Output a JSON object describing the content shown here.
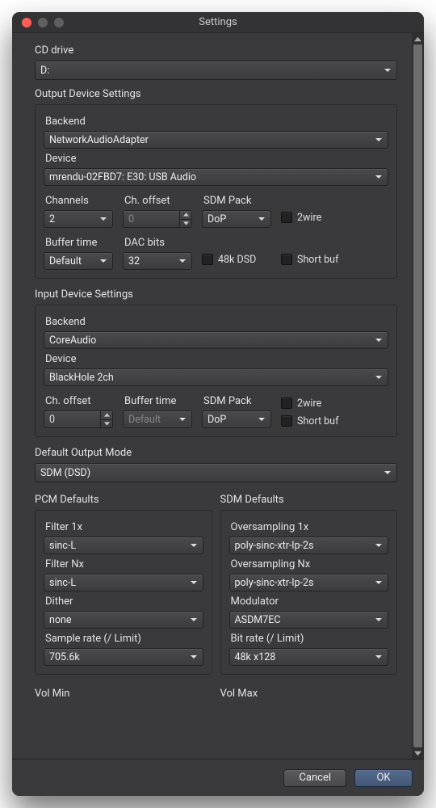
{
  "window": {
    "title": "Settings"
  },
  "cd": {
    "label": "CD drive",
    "value": "D:"
  },
  "output": {
    "title": "Output Device Settings",
    "backend_label": "Backend",
    "backend": "NetworkAudioAdapter",
    "device_label": "Device",
    "device": "mrendu-02FBD7: E30: USB Audio",
    "channels_label": "Channels",
    "channels": "2",
    "ch_offset_label": "Ch. offset",
    "ch_offset": "0",
    "sdm_pack_label": "SDM Pack",
    "sdm_pack": "DoP",
    "twowire_label": "2wire",
    "buffer_time_label": "Buffer time",
    "buffer_time": "Default",
    "dac_bits_label": "DAC bits",
    "dac_bits": "32",
    "dsd48k_label": "48k DSD",
    "short_buf_label": "Short buf"
  },
  "input": {
    "title": "Input Device Settings",
    "backend_label": "Backend",
    "backend": "CoreAudio",
    "device_label": "Device",
    "device": "BlackHole 2ch",
    "ch_offset_label": "Ch. offset",
    "ch_offset": "0",
    "buffer_time_label": "Buffer time",
    "buffer_time": "Default",
    "sdm_pack_label": "SDM Pack",
    "sdm_pack": "DoP",
    "twowire_label": "2wire",
    "short_buf_label": "Short buf"
  },
  "outmode": {
    "label": "Default Output Mode",
    "value": "SDM (DSD)"
  },
  "pcm": {
    "title": "PCM Defaults",
    "filter1x_label": "Filter 1x",
    "filter1x": "sinc-L",
    "filternx_label": "Filter Nx",
    "filternx": "sinc-L",
    "dither_label": "Dither",
    "dither": "none",
    "sr_label": "Sample rate (/ Limit)",
    "sr": "705.6k"
  },
  "sdm": {
    "title": "SDM Defaults",
    "os1x_label": "Oversampling 1x",
    "os1x": "poly-sinc-xtr-lp-2s",
    "osnx_label": "Oversampling Nx",
    "osnx": "poly-sinc-xtr-lp-2s",
    "mod_label": "Modulator",
    "mod": "ASDM7EC",
    "br_label": "Bit rate (/ Limit)",
    "br": "48k x128"
  },
  "vol": {
    "min_label": "Vol Min",
    "max_label": "Vol Max"
  },
  "buttons": {
    "cancel": "Cancel",
    "ok": "OK"
  }
}
